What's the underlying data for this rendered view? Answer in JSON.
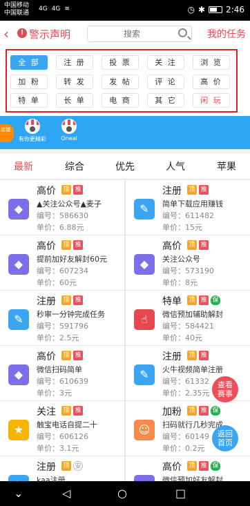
{
  "status": {
    "carrier1": "中国移动",
    "carrier2": "中国联通",
    "net1": "4G",
    "net2": "4G",
    "time": "2:46"
  },
  "header": {
    "title": "警示声明",
    "search_placeholder": "搜索",
    "my_tasks": "我的任务"
  },
  "filters": [
    "全 部",
    "注 册",
    "投 票",
    "关 注",
    "浏 览",
    "加 粉",
    "转 发",
    "发 帖",
    "评 论",
    "高 价",
    "特 单",
    "长 单",
    "电 商",
    "其 它",
    "闲 玩"
  ],
  "shop_badge": "店铺",
  "users": [
    {
      "name": "有你更精彩"
    },
    {
      "name": "Oneal"
    }
  ],
  "tabs": [
    "最新",
    "综合",
    "优先",
    "人气",
    "苹果"
  ],
  "labels": {
    "code": "编号：",
    "price": "单价：",
    "ding": "顶",
    "tui": "推",
    "bao": "保",
    "an": "安"
  },
  "cards": [
    {
      "title": "高价",
      "desc": "▲关注公众号▲麦子",
      "code": "586630",
      "price": "6.88元"
    },
    {
      "title": "注册",
      "desc": "简单下载应用赚钱",
      "code": "611482",
      "price": "15元"
    },
    {
      "title": "高价",
      "desc": "提前加好友解封60元",
      "code": "607234",
      "price": "60元"
    },
    {
      "title": "高价",
      "desc": "关注公众号",
      "code": "573190",
      "price": "8元"
    },
    {
      "title": "注册",
      "desc": "秒审一分钟完成任务",
      "code": "591796",
      "price": "2.5元"
    },
    {
      "title": "特单",
      "desc": "微信预加辅助解封",
      "code": "584421",
      "price": "40元"
    },
    {
      "title": "高价",
      "desc": "微信扫码简单",
      "code": "610639",
      "price": "3元"
    },
    {
      "title": "注册",
      "desc": "火牛视频简单注册",
      "code": "61332",
      "price": "2.35元"
    },
    {
      "title": "关注",
      "desc": "触宝电话自提二十",
      "code": "606126",
      "price": "3.1元"
    },
    {
      "title": "加粉",
      "desc": "扫码就行几秒完成",
      "code": "60149",
      "price": "0.2元"
    },
    {
      "title": "注册",
      "desc": "kaa注册",
      "code": "",
      "price": ""
    },
    {
      "title": "高价",
      "desc": "微信预加好友解封",
      "code": "",
      "price": ""
    }
  ],
  "fabs": {
    "view_match": "查看\n赛事",
    "back_home": "返回\n首页"
  }
}
